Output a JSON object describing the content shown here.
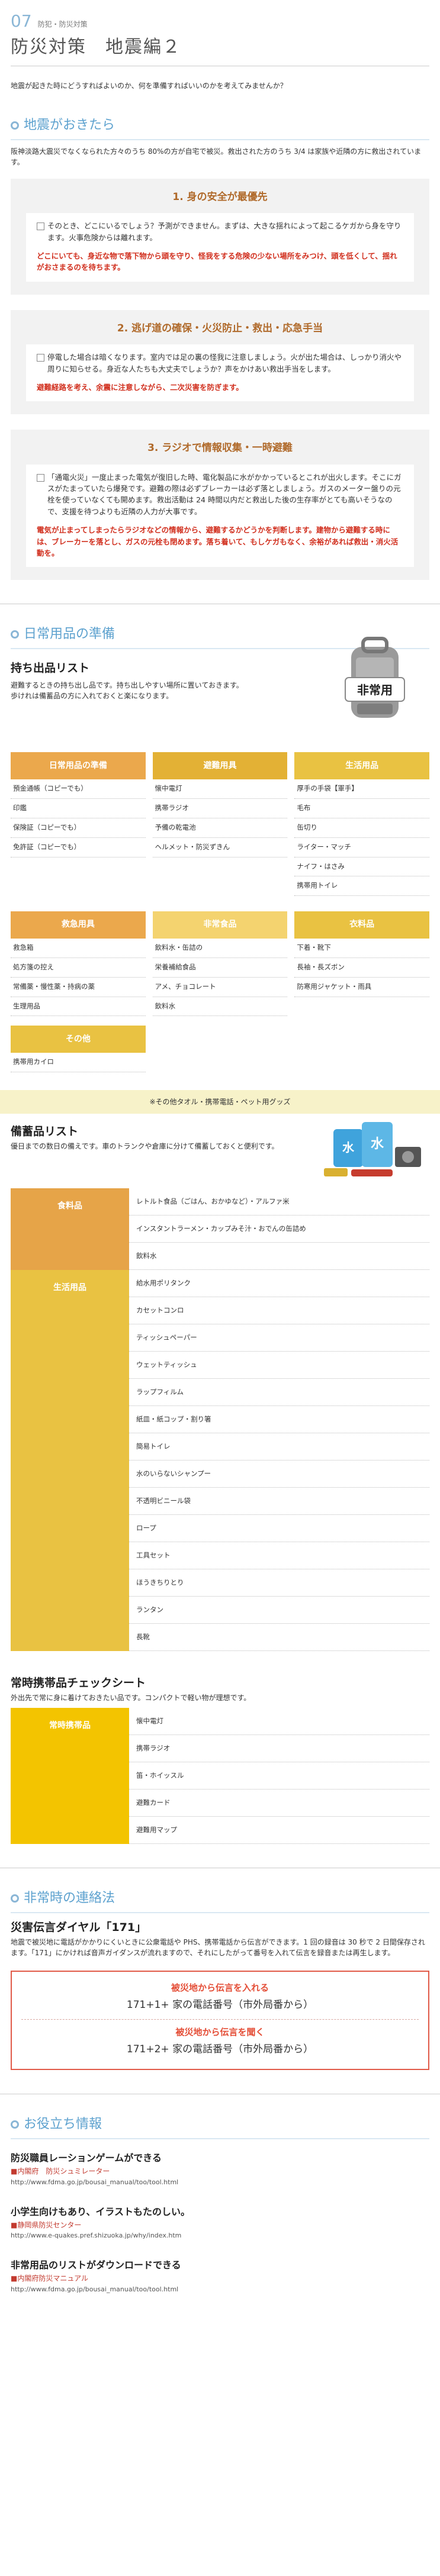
{
  "header": {
    "number": "07",
    "category": "防犯・防災対策",
    "title": "防災対策　地震編２"
  },
  "intro": "地震が起きた時にどうすればよいのか、何を準備すればいいのかを考えてみませんか？",
  "s1": {
    "heading": "地震がおきたら",
    "lead": "阪神淡路大震災でなくなられた方々のうち 80%の方が自宅で被災。救出された方のうち 3/4 は家族や近隣の方に救出されています。",
    "boxes": [
      {
        "title": "1. 身の安全が最優先",
        "q": "そのとき、どこにいるでしょう？予測ができません。まずは、大きな揺れによって起こるケガから身を守ります。火事危険からは離れます。",
        "a": "どこにいても、身近な物で落下物から頭を守り、怪我をする危険の少ない場所をみつけ、頭を低くして、揺れがおさまるのを待ちます。"
      },
      {
        "title": "2. 逃げ道の確保・火災防止・救出・応急手当",
        "q": "停電した場合は暗くなります。室内では足の裏の怪我に注意しましょう。火が出た場合は、しっかり消火や周りに知らせる。身近な人たちも大丈夫でしょうか？声をかけあい救出手当をします。",
        "a": "避難経路を考え、余震に注意しながら、二次災害を防ぎます。"
      },
      {
        "title": "3. ラジオで情報収集・一時避難",
        "q": "「通電火災」一度止まった電気が復旧した時、電化製品に水がかかっているとこれが出火します。そこにガスがたまっていたら爆発です。避難の際は必ずブレーカーは必ず落としましょう。ガスのメーター盤りの元栓を使っていなくても開めます。救出活動は 24 時間以内だと救出した後の生存率がとても高いそうなので、支援を待つよりも近隣の人力が大事です。",
        "a": "電気が止まってしまったらラジオなどの情報から、避難するかどうかを判断します。建物から避難する時には、ブレーカーを落とし、ガスの元栓も閉めます。落ち着いて、もしケガもなく、余裕があれば救出・消火活動を。"
      }
    ]
  },
  "s2": {
    "heading": "日常用品の準備",
    "carry": {
      "title": "持ち出品リスト",
      "lead": "避難するときの持ち出し品です。持ち出しやすい場所に置いておきます。\n歩けれは備蓄品の方に入れておくと楽になります。",
      "bag_label": "非常用"
    },
    "cats1": [
      {
        "name": "日常用品の準備",
        "items": [
          "預金通帳（コピーでも）",
          "印鑑",
          "保険証（コピーでも）",
          "免許証（コピーでも）"
        ]
      },
      {
        "name": "避難用具",
        "items": [
          "懐中電灯",
          "携帯ラジオ",
          "予備の乾電池",
          "ヘルメット・防災ずきん"
        ]
      },
      {
        "name": "生活用品",
        "items": [
          "厚手の手袋【軍手】",
          "毛布",
          "缶切り",
          "ライター・マッチ",
          "ナイフ・はさみ",
          "携帯用トイレ"
        ]
      }
    ],
    "cats2": [
      {
        "name": "救急用具",
        "items": [
          "救急箱",
          "処方箋の控え",
          "常備薬・慢性薬・持病の薬",
          "生理用品"
        ]
      },
      {
        "name": "非常食品",
        "items": [
          "飲料水・缶詰の",
          "栄養補給食品",
          "アメ、チョコレート",
          "飲料水"
        ]
      },
      {
        "name": "衣料品",
        "items": [
          "下着・靴下",
          "長袖・長ズボン",
          "防寒用ジャケット・雨具"
        ]
      }
    ],
    "other": {
      "name": "その他",
      "items": [
        "携帯用カイロ"
      ]
    },
    "band": "※その他タオル・携帯電話・ペット用グッズ",
    "stock": {
      "title": "備蓄品リスト",
      "lead": "優日までの数日の備えです。車のトランクや倉庫に分けて備蓄しておくと便利です。",
      "tank_label": "水",
      "rows": [
        {
          "name": "食料品",
          "items": [
            "レトルト食品（ごはん、おかゆなど）・アルファ米",
            "インスタントラーメン・カップみそ汁・おでんの缶詰め",
            "飲料水"
          ]
        },
        {
          "name": "生活用品",
          "items": [
            "給水用ポリタンク",
            "カセットコンロ",
            "ティッシュペーパー",
            "ウェットティッシュ",
            "ラップフィルム",
            "紙皿・紙コップ・割り箸",
            "簡易トイレ",
            "水のいらないシャンプー",
            "不透明ビニール袋",
            "ロープ",
            "工具セット",
            "ほうきちりとり",
            "ランタン",
            "長靴"
          ]
        }
      ]
    },
    "always": {
      "title": "常時携帯品チェックシート",
      "lead": "外出先で常に身に着けておきたい品です。コンパクトで軽い物が理想です。",
      "rows": [
        {
          "name": "常時携帯品",
          "items": [
            "懐中電灯",
            "携帯ラジオ",
            "笛・ホイッスル",
            "避難カード",
            "避難用マップ"
          ]
        }
      ]
    }
  },
  "s3": {
    "heading": "非常時の連絡法",
    "title": "災害伝言ダイヤル「171」",
    "lead": "地震で被災地に電話がかかりにくいときに公衆電話や PHS、携帯電話から伝言ができます。1 回の録音は 30 秒で 2 日間保存されます。「171」にかければ音声ガイダンスが流れますので、それにしたがって番号を入れて伝言を録音または再生します。",
    "record_cap": "被災地から伝言を入れる",
    "record_num": "171+1+ 家の電話番号（市外局番から）",
    "play_cap": "被災地から伝言を聞く",
    "play_num": "171+2+ 家の電話番号（市外局番から）"
  },
  "s4": {
    "heading": "お役立ち情報",
    "links": [
      {
        "t": "防災職員レーションゲームができる",
        "s": "■内閣府　防災シュミレーター",
        "u": "http://www.fdma.go.jp/bousai_manual/too/tool.html"
      },
      {
        "t": "小学生向けもあり、イラストもたのしい。",
        "s": "■静岡県防災センター",
        "u": "http://www.e-quakes.pref.shizuoka.jp/why/index.htm"
      },
      {
        "t": "非常用品のリストがダウンロードできる",
        "s": "■内閣府防災マニュアル",
        "u": "http://www.fdma.go.jp/bousai_manual/too/tool.html"
      }
    ]
  }
}
